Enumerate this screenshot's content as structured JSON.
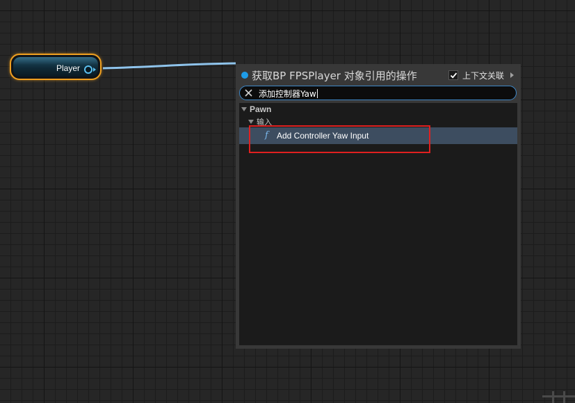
{
  "node": {
    "label": "Player",
    "border_color": "#f0a020",
    "pin_color": "#5bc0f0"
  },
  "menu": {
    "title": "获取BP FPSPlayer 对象引用的操作",
    "dot_color": "#1e9ce8",
    "context_sensitive": {
      "label": "上下文关联",
      "checked": true
    },
    "search": {
      "value": "添加控制器Yaw",
      "clear_icon": "close-icon"
    },
    "tree": {
      "category": "Pawn",
      "subcategory": "输入",
      "items": [
        {
          "icon": "f",
          "label": "Add Controller Yaw Input",
          "selected": true
        }
      ]
    }
  },
  "annotation": {
    "highlight_color": "#e02020"
  }
}
